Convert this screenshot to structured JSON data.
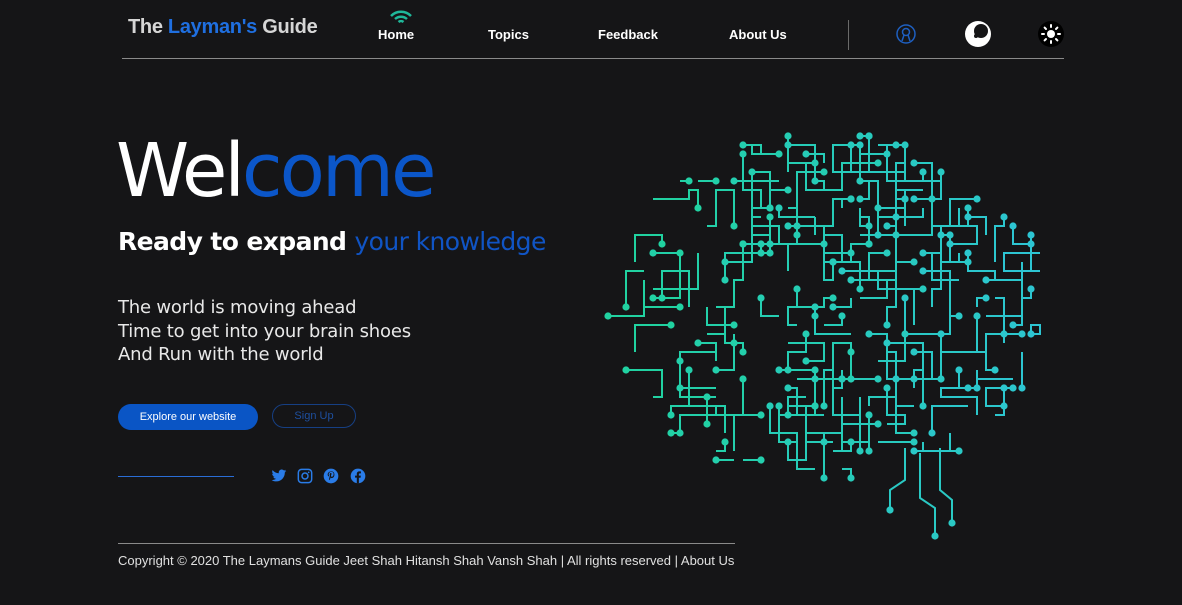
{
  "header": {
    "logo": {
      "part1": "The ",
      "part2": "Layman's",
      "part3": " Guide"
    },
    "nav": [
      {
        "label": "Home"
      },
      {
        "label": "Topics"
      },
      {
        "label": "Feedback"
      },
      {
        "label": "About Us"
      }
    ],
    "icons": [
      "user-icon",
      "dark-mode-icon",
      "light-mode-icon"
    ]
  },
  "hero": {
    "title_part1": "Wel",
    "title_part2": "come",
    "subtitle_part1": "Ready to expand ",
    "subtitle_part2": "your knowledge",
    "tagline": [
      "The world is moving ahead",
      "Time to get into your brain shoes",
      "And Run with the world"
    ],
    "primary_button": "Explore our website",
    "secondary_button": "Sign Up"
  },
  "social": [
    "twitter-icon",
    "instagram-icon",
    "pinterest-icon",
    "facebook-icon"
  ],
  "footer": {
    "text": "Copyright © 2020 The Laymans Guide Jeet Shah Hitansh Shah Vansh Shah | All rights reserved | About Us"
  },
  "colors": {
    "accent": "#0b56c9",
    "background": "#151517",
    "brain_green": "#1fd49a",
    "brain_cyan": "#2ec4d6"
  }
}
